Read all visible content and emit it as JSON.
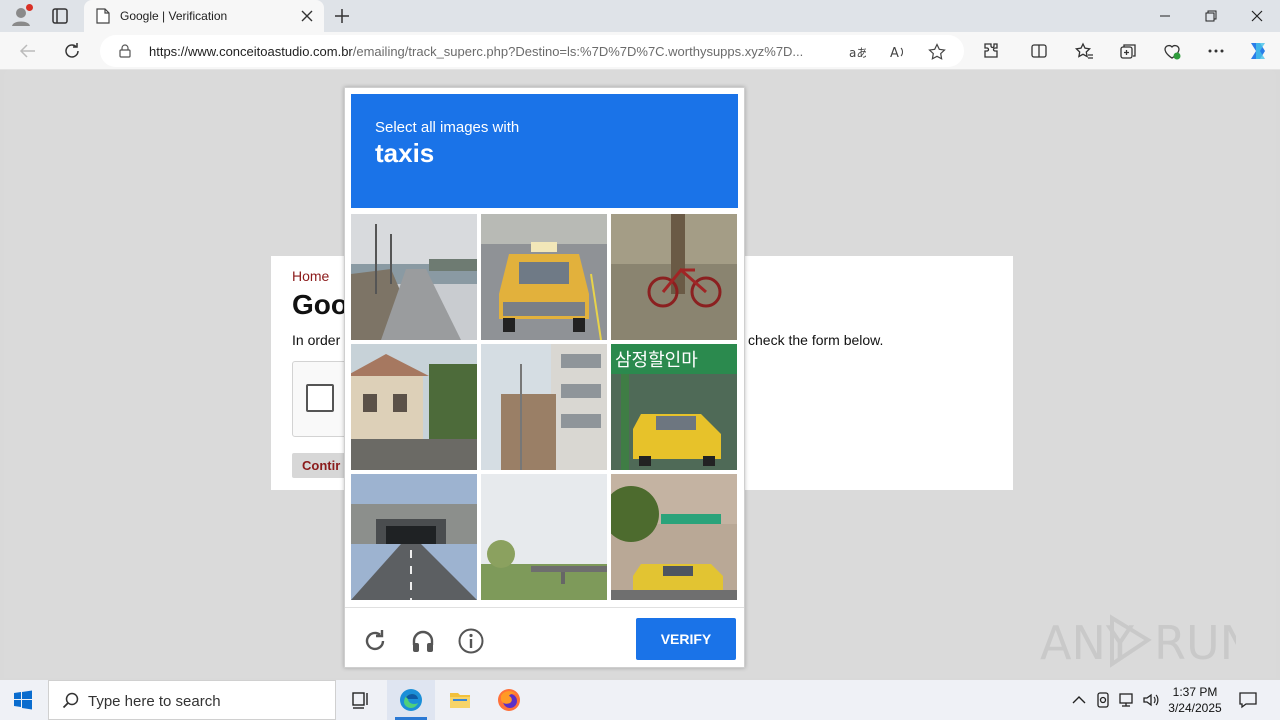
{
  "browser": {
    "tab_title": "Google | Verification",
    "url_host": "https://www.conceitoastudio.com.br",
    "url_rest": "/emailing/track_superc.php?Destino=ls:%7D%7D%7C.worthysupps.xyz%7D..."
  },
  "page": {
    "breadcrumb": "Home",
    "heading": "Goo",
    "intro_left": "In order",
    "intro_right": "check the form below.",
    "continue_label": "Contir"
  },
  "captcha": {
    "instruction": "Select all images with",
    "target": "taxis",
    "tiles": [
      {
        "name": "tile-1",
        "icon": "road-by-river"
      },
      {
        "name": "tile-2",
        "icon": "taxi-front"
      },
      {
        "name": "tile-3",
        "icon": "bicycle"
      },
      {
        "name": "tile-4",
        "icon": "house"
      },
      {
        "name": "tile-5",
        "icon": "buildings"
      },
      {
        "name": "tile-6",
        "icon": "taxi-korean-storefront"
      },
      {
        "name": "tile-7",
        "icon": "tunnel"
      },
      {
        "name": "tile-8",
        "icon": "bridge"
      },
      {
        "name": "tile-9",
        "icon": "taxi-street"
      }
    ],
    "verify_label": "VERIFY",
    "accent": "#1a73e8"
  },
  "taskbar": {
    "search_placeholder": "Type here to search",
    "time": "1:37 PM",
    "date": "3/24/2025"
  },
  "watermark": "ANY RUN"
}
